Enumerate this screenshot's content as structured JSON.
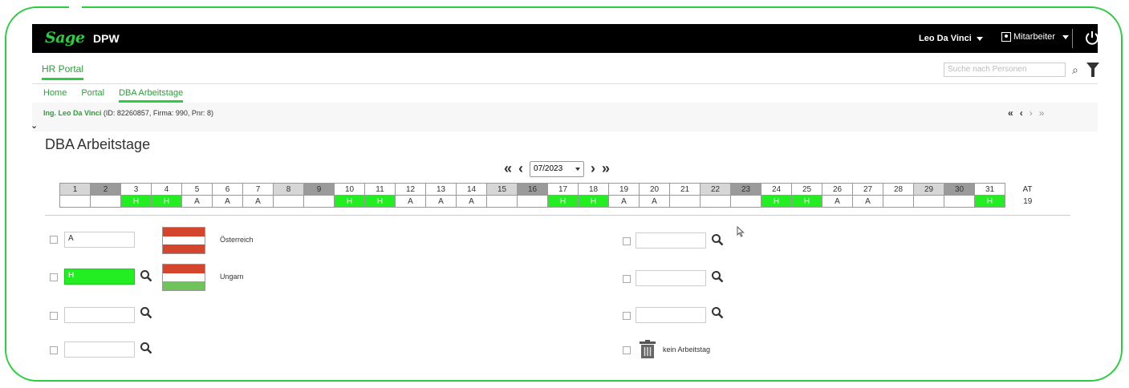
{
  "app": {
    "brand": "Sage",
    "name": "DPW"
  },
  "user": {
    "name": "Leo Da Vinci",
    "role": "Mitarbeiter"
  },
  "nav": {
    "hr_portal": "HR Portal"
  },
  "search": {
    "placeholder": "Suche nach Personen"
  },
  "breadcrumbs": [
    "Home",
    "Portal",
    "DBA Arbeitstage"
  ],
  "employee": {
    "name": "Ing. Leo Da Vinci",
    "details": "(ID: 82260857, Firma: 990, Pnr: 8)"
  },
  "pager": {
    "first": "«",
    "prev": "‹",
    "next": "›",
    "last": "»"
  },
  "page_title": "DBA Arbeitstage",
  "month": {
    "value": "07/2023",
    "first": "«",
    "prev": "‹",
    "next": "›",
    "last": "»"
  },
  "calendar": {
    "days": [
      "1",
      "2",
      "3",
      "4",
      "5",
      "6",
      "7",
      "8",
      "9",
      "10",
      "11",
      "12",
      "13",
      "14",
      "15",
      "16",
      "17",
      "18",
      "19",
      "20",
      "21",
      "22",
      "23",
      "24",
      "25",
      "26",
      "27",
      "28",
      "29",
      "30",
      "31"
    ],
    "values": [
      "",
      "",
      "H",
      "H",
      "A",
      "A",
      "A",
      "",
      "",
      "H",
      "H",
      "A",
      "A",
      "A",
      "",
      "",
      "H",
      "H",
      "A",
      "A",
      "",
      "",
      "",
      "H",
      "H",
      "A",
      "A",
      "",
      "",
      "",
      "H"
    ],
    "day_types": [
      "sat",
      "sun",
      "",
      "",
      "",
      "",
      "",
      "sat",
      "sun",
      "",
      "",
      "",
      "",
      "",
      "sat",
      "sun",
      "",
      "",
      "",
      "",
      "",
      "sat",
      "sun",
      "",
      "",
      "",
      "",
      "",
      "sat",
      "sun",
      ""
    ],
    "at_label": "AT",
    "at_value": "19"
  },
  "legend": {
    "left": [
      {
        "code": "A",
        "label": "Österreich",
        "flag": [
          "#d4452e",
          "#ffffff",
          "#d4452e"
        ]
      },
      {
        "code": "H",
        "label": "Ungarn",
        "flag": [
          "#d4452e",
          "#ffffff",
          "#6fc35a"
        ]
      },
      {
        "code": "",
        "label": ""
      },
      {
        "code": "",
        "label": ""
      }
    ],
    "right": [
      {
        "code": "",
        "label": ""
      },
      {
        "code": "",
        "label": ""
      },
      {
        "code": "",
        "label": ""
      },
      {
        "code": "",
        "label": "kein Arbeitstag"
      }
    ]
  },
  "colors": {
    "accent": "#2ecc40",
    "holiday": "#22ee22",
    "weekend": "#d6d6d6",
    "sunday": "#9a9a9a"
  }
}
